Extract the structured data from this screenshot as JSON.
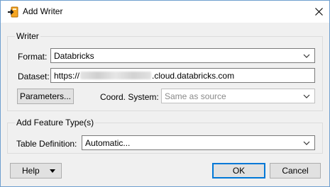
{
  "window": {
    "title": "Add Writer",
    "app_icon": "fme-writer-icon",
    "close_icon": "close-icon"
  },
  "writer_group": {
    "legend": "Writer",
    "format_label": "Format:",
    "format_value": "Databricks",
    "dataset_label": "Dataset:",
    "dataset_prefix": "https://",
    "dataset_suffix": ".cloud.databricks.com",
    "parameters_button": "Parameters...",
    "coord_system_label": "Coord. System:",
    "coord_system_placeholder": "Same as source"
  },
  "feature_type_group": {
    "legend": "Add Feature Type(s)",
    "table_definition_label": "Table Definition:",
    "table_definition_value": "Automatic..."
  },
  "footer": {
    "help_button": "Help",
    "ok_button": "OK",
    "cancel_button": "Cancel"
  },
  "colors": {
    "accent": "#0078d7",
    "dialog_background": "#f0f0f0"
  }
}
